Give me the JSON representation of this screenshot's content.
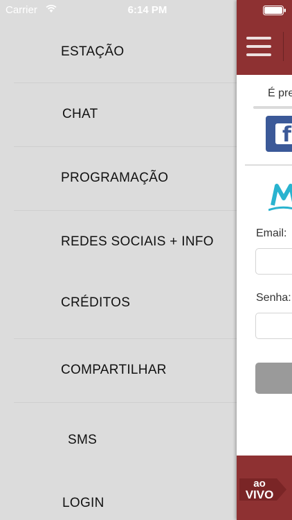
{
  "status_bar": {
    "carrier": "Carrier",
    "time": "6:14 PM",
    "wifi_icon": "wifi-icon",
    "battery_icon": "battery-icon"
  },
  "menu": {
    "items": [
      {
        "label": "ESTAÇÃO"
      },
      {
        "label": "CHAT"
      },
      {
        "label": "PROGRAMAÇÃO"
      },
      {
        "label": "REDES SOCIAIS + INFO"
      },
      {
        "label": "CRÉDITOS"
      },
      {
        "label": "COMPARTILHAR"
      },
      {
        "label": "SMS"
      },
      {
        "label": "LOGIN"
      }
    ]
  },
  "main": {
    "menu_icon": "hamburger-icon",
    "prompt_text": "É pre",
    "facebook_icon": "facebook-icon",
    "email_label": "Email:",
    "password_label": "Senha:",
    "live_badge": {
      "line1": "ao",
      "line2": "VIVO"
    }
  },
  "colors": {
    "drawer_background": "#dcdcdc",
    "brand": "#8e3132",
    "facebook": "#3b5998",
    "logo_accent": "#29b3cf",
    "button_disabled": "#9a9a9a"
  }
}
